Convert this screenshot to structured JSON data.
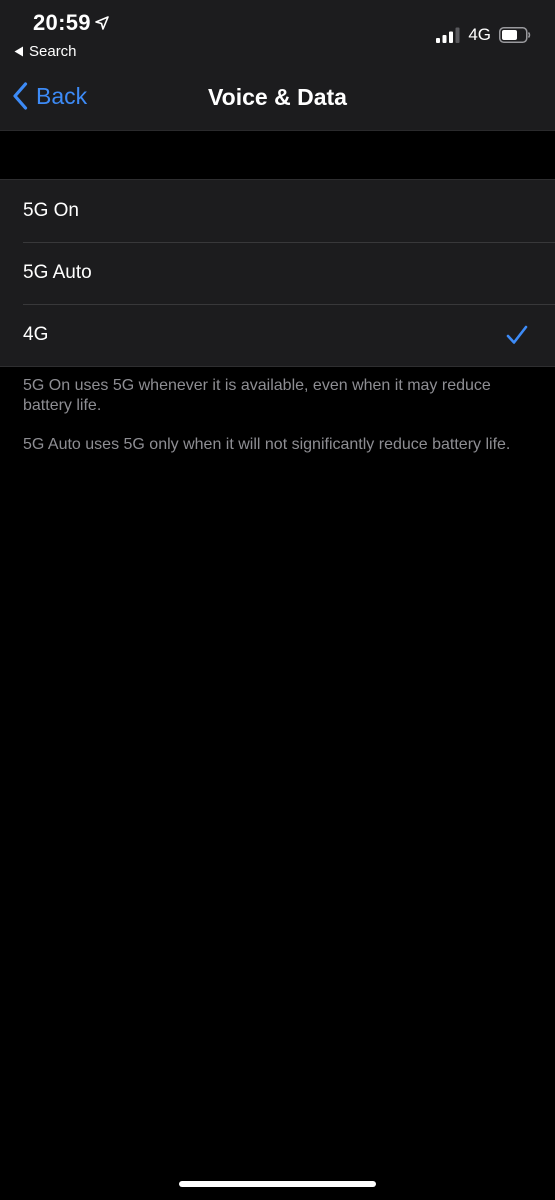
{
  "status_bar": {
    "time": "20:59",
    "back_app_label": "Search",
    "network": "4G",
    "icons": [
      "location-arrow-icon",
      "back-triangle-icon",
      "cellular-signal-icon",
      "battery-icon"
    ]
  },
  "nav": {
    "back_label": "Back",
    "title": "Voice & Data"
  },
  "options": [
    {
      "label": "5G On",
      "selected": false
    },
    {
      "label": "5G Auto",
      "selected": false
    },
    {
      "label": "4G",
      "selected": true
    }
  ],
  "footnotes": [
    "5G On uses 5G whenever it is available, even when it may reduce battery life.",
    "5G Auto uses 5G only when it will not significantly reduce battery life."
  ],
  "colors": {
    "accent": "#3d8bf7",
    "background": "#000000",
    "grouped_cell": "#1c1c1e",
    "secondary_text": "#8e8e93"
  }
}
